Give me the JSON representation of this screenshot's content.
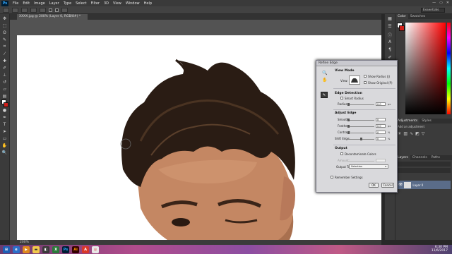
{
  "app": {
    "logo": "Ps",
    "menu": [
      "File",
      "Edit",
      "Image",
      "Layer",
      "Type",
      "Select",
      "Filter",
      "3D",
      "View",
      "Window",
      "Help"
    ],
    "window_controls": [
      "—",
      "▭",
      "✕"
    ]
  },
  "options_bar": {
    "essentials": "Essentials"
  },
  "document_tab": {
    "label": "XXXX.jpg @ 200% (Layer 0, RGB/8#) *"
  },
  "status_bar": {
    "zoom": "200%"
  },
  "panels": {
    "color_tabs": [
      "Color",
      "Swatches"
    ],
    "adjust_tabs": [
      "Adjustments",
      "Styles"
    ],
    "adjust_title": "Add an adjustment",
    "layers_tabs": [
      "Layers",
      "Channels",
      "Paths"
    ],
    "layer_name": "Layer 0"
  },
  "dialog": {
    "title": "Refine Edge",
    "view_mode": {
      "heading": "View Mode",
      "view_label": "View:",
      "show_radius": "Show Radius (J)",
      "show_original": "Show Original (P)"
    },
    "edge_detection": {
      "heading": "Edge Detection",
      "smart_radius": "Smart Radius",
      "radius_label": "Radius:",
      "radius_value": "0.0",
      "radius_unit": "px"
    },
    "adjust_edge": {
      "heading": "Adjust Edge",
      "smooth_label": "Smooth:",
      "smooth_value": "0",
      "feather_label": "Feather:",
      "feather_value": "0.0",
      "feather_unit": "px",
      "contrast_label": "Contrast:",
      "contrast_value": "0",
      "contrast_unit": "%",
      "shift_label": "Shift Edge:",
      "shift_value": "0",
      "shift_unit": "%"
    },
    "output": {
      "heading": "Output",
      "decontaminate": "Decontaminate Colors",
      "amount_label": "Amount:",
      "output_to_label": "Output To:",
      "output_to_value": "Selection"
    },
    "remember": "Remember Settings",
    "ok": "OK",
    "cancel": "Cancel"
  },
  "taskbar": {
    "time": "6:30 PM",
    "date": "11/6/2017"
  },
  "colors": {
    "foreground": "#ffffff",
    "background": "#d0201a"
  }
}
